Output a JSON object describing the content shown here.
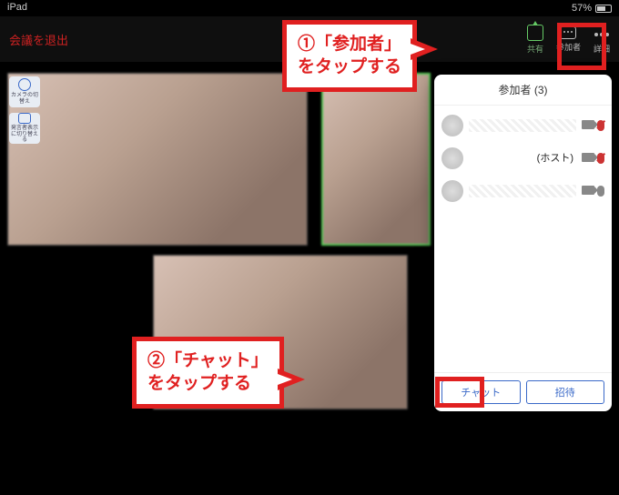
{
  "statusbar": {
    "device": "iPad",
    "battery": "57%"
  },
  "topbar": {
    "leave": "会議を退出",
    "share": "共有",
    "participants": "参加者",
    "more": "詳細"
  },
  "leftControls": {
    "camera_switch": "カメラの切替え",
    "speaker_switch": "発言者表示に切り替える"
  },
  "panel": {
    "title": "参加者 (3)",
    "items": [
      {
        "host": "",
        "muted": true
      },
      {
        "host": "(ホスト)",
        "muted": true
      },
      {
        "host": "",
        "muted": false
      }
    ],
    "chat_label": "チャット",
    "invite_label": "招待"
  },
  "callouts": {
    "c1_line1": "①「参加者」",
    "c1_line2": "をタップする",
    "c2_line1": "②「チャット」",
    "c2_line2": "をタップする"
  }
}
